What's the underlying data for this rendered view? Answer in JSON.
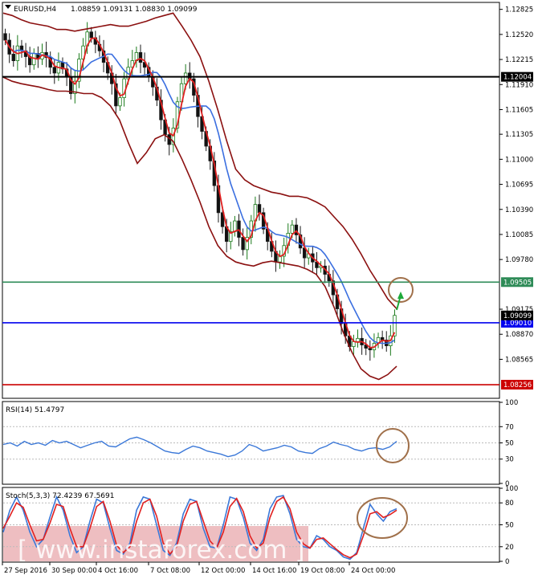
{
  "chart_data": {
    "type": "candlestick",
    "header": {
      "symbol_tf": "EURUSD,H4",
      "ohlc": "1.08859 1.09131 1.08830 1.09099"
    },
    "price_axis": {
      "ylim": [
        1.081,
        1.129
      ],
      "ticks": [
        "1.12825",
        "1.12520",
        "1.12215",
        "1.11910",
        "1.11605",
        "1.11305",
        "1.11000",
        "1.10695",
        "1.10390",
        "1.10085",
        "1.09780",
        "1.09175",
        "1.08870",
        "1.08565"
      ]
    },
    "levels": [
      {
        "value": 1.12004,
        "label": "1.12004",
        "color": "#000000",
        "bg": "#000000",
        "fg": "#ffffff"
      },
      {
        "value": 1.09505,
        "label": "1.09505",
        "color": "#2e8b57",
        "bg": "#2e8b57",
        "fg": "#ffffff"
      },
      {
        "value": 1.0901,
        "label": "1.09010",
        "color": "#0000ee",
        "bg": "#0000ee",
        "fg": "#ffffff"
      },
      {
        "value": 1.08256,
        "label": "1.08256",
        "color": "#cc0000",
        "bg": "#cc0000",
        "fg": "#ffffff"
      }
    ],
    "last_price": {
      "value": 1.09099,
      "label": "1.09099"
    },
    "closes": [
      1.1245,
      1.1228,
      1.122,
      1.1238,
      1.1232,
      1.1225,
      1.1215,
      1.1229,
      1.1222,
      1.123,
      1.1224,
      1.1212,
      1.1205,
      1.1218,
      1.121,
      1.12,
      1.118,
      1.1195,
      1.1222,
      1.1238,
      1.1255,
      1.1248,
      1.124,
      1.1232,
      1.1218,
      1.1205,
      1.1192,
      1.1165,
      1.1175,
      1.1198,
      1.1212,
      1.122,
      1.123,
      1.1218,
      1.1212,
      1.12,
      1.1188,
      1.1172,
      1.1148,
      1.113,
      1.1118,
      1.1138,
      1.117,
      1.1192,
      1.1205,
      1.1198,
      1.1178,
      1.1152,
      1.1134,
      1.1116,
      1.1098,
      1.1068,
      1.1035,
      1.1018,
      1.1,
      1.1012,
      1.1025,
      1.1005,
      1.099,
      1.1005,
      1.1025,
      1.1045,
      1.1035,
      1.1015,
      1.1,
      1.0988,
      1.0975,
      1.0982,
      1.0995,
      1.101,
      1.102,
      1.1008,
      1.0992,
      1.098,
      1.0985,
      1.0975,
      1.0968,
      1.097,
      1.096,
      1.0952,
      1.0935,
      1.0918,
      1.09,
      1.0885,
      1.0872,
      1.0878,
      1.0882,
      1.0874,
      1.087,
      1.0868,
      1.0876,
      1.0883,
      1.088,
      1.0873,
      1.0885,
      1.091
    ],
    "bands_upper": [
      1.1278,
      1.1275,
      1.127,
      1.1266,
      1.1264,
      1.1262,
      1.1258,
      1.1258,
      1.1256,
      1.1258,
      1.126,
      1.1262,
      1.1264,
      1.1262,
      1.1262,
      1.1265,
      1.1268,
      1.1272,
      1.1275,
      1.1278,
      1.1262,
      1.1245,
      1.1225,
      1.1195,
      1.116,
      1.1122,
      1.1088,
      1.1075,
      1.1068,
      1.1064,
      1.106,
      1.1058,
      1.1055,
      1.1055,
      1.1053,
      1.1048,
      1.1042,
      1.103,
      1.1018,
      1.1003,
      1.0985,
      1.0965,
      1.0948,
      1.093,
      1.0918
    ],
    "bands_lower": [
      1.12,
      1.1195,
      1.1192,
      1.119,
      1.1188,
      1.1185,
      1.1183,
      1.1183,
      1.1182,
      1.118,
      1.118,
      1.1175,
      1.1165,
      1.1148,
      1.112,
      1.1095,
      1.1108,
      1.1125,
      1.113,
      1.1122,
      1.11,
      1.1075,
      1.1048,
      1.1018,
      1.0995,
      1.0982,
      1.0975,
      1.0972,
      1.097,
      1.0974,
      1.0976,
      1.0974,
      1.0972,
      1.097,
      1.0966,
      1.096,
      1.0945,
      1.092,
      1.089,
      1.0865,
      1.0845,
      1.0836,
      1.0832,
      1.0838,
      1.0848
    ],
    "rsi": {
      "label": "RSI(14) 51.4797",
      "ylim": [
        0,
        100
      ],
      "ticks": [
        "100",
        "70",
        "50",
        "30",
        "0"
      ],
      "values": [
        48,
        50,
        46,
        52,
        48,
        50,
        47,
        53,
        50,
        52,
        48,
        44,
        47,
        50,
        52,
        46,
        45,
        50,
        55,
        57,
        54,
        50,
        45,
        40,
        38,
        37,
        42,
        46,
        44,
        40,
        38,
        36,
        33,
        35,
        40,
        48,
        45,
        40,
        42,
        44,
        47,
        45,
        40,
        38,
        37,
        43,
        46,
        51,
        48,
        46,
        42,
        40,
        43,
        44,
        42,
        45,
        52
      ]
    },
    "stoch": {
      "label": "Stoch(5,3,3) 72.4239 67.5691",
      "ylim": [
        0,
        100
      ],
      "ticks": [
        "100",
        "80",
        "50",
        "20",
        "0"
      ],
      "main": [
        40,
        70,
        88,
        70,
        40,
        20,
        30,
        60,
        88,
        70,
        35,
        12,
        20,
        55,
        85,
        80,
        45,
        15,
        10,
        25,
        70,
        88,
        85,
        50,
        15,
        8,
        25,
        65,
        85,
        82,
        45,
        20,
        18,
        50,
        88,
        85,
        60,
        25,
        15,
        30,
        72,
        88,
        90,
        65,
        30,
        20,
        18,
        35,
        30,
        20,
        15,
        6,
        3,
        12,
        45,
        78,
        65,
        55,
        68,
        72
      ],
      "signal": [
        45,
        62,
        80,
        74,
        50,
        28,
        30,
        52,
        78,
        75,
        45,
        20,
        20,
        45,
        75,
        82,
        55,
        22,
        12,
        20,
        55,
        80,
        85,
        62,
        25,
        10,
        20,
        55,
        78,
        82,
        55,
        28,
        18,
        40,
        75,
        86,
        68,
        35,
        18,
        25,
        60,
        82,
        88,
        72,
        40,
        24,
        18,
        30,
        32,
        24,
        16,
        9,
        5,
        10,
        35,
        65,
        68,
        60,
        64,
        70
      ]
    },
    "time_axis": [
      "27 Sep 2016",
      "30 Sep 00:00",
      "4 Oct 16:00",
      "7 Oct 08:00",
      "12 Oct 00:00",
      "14 Oct 16:00",
      "19 Oct 08:00",
      "24 Oct 00:00"
    ],
    "watermark": "[ www.instaforex.com ]"
  }
}
